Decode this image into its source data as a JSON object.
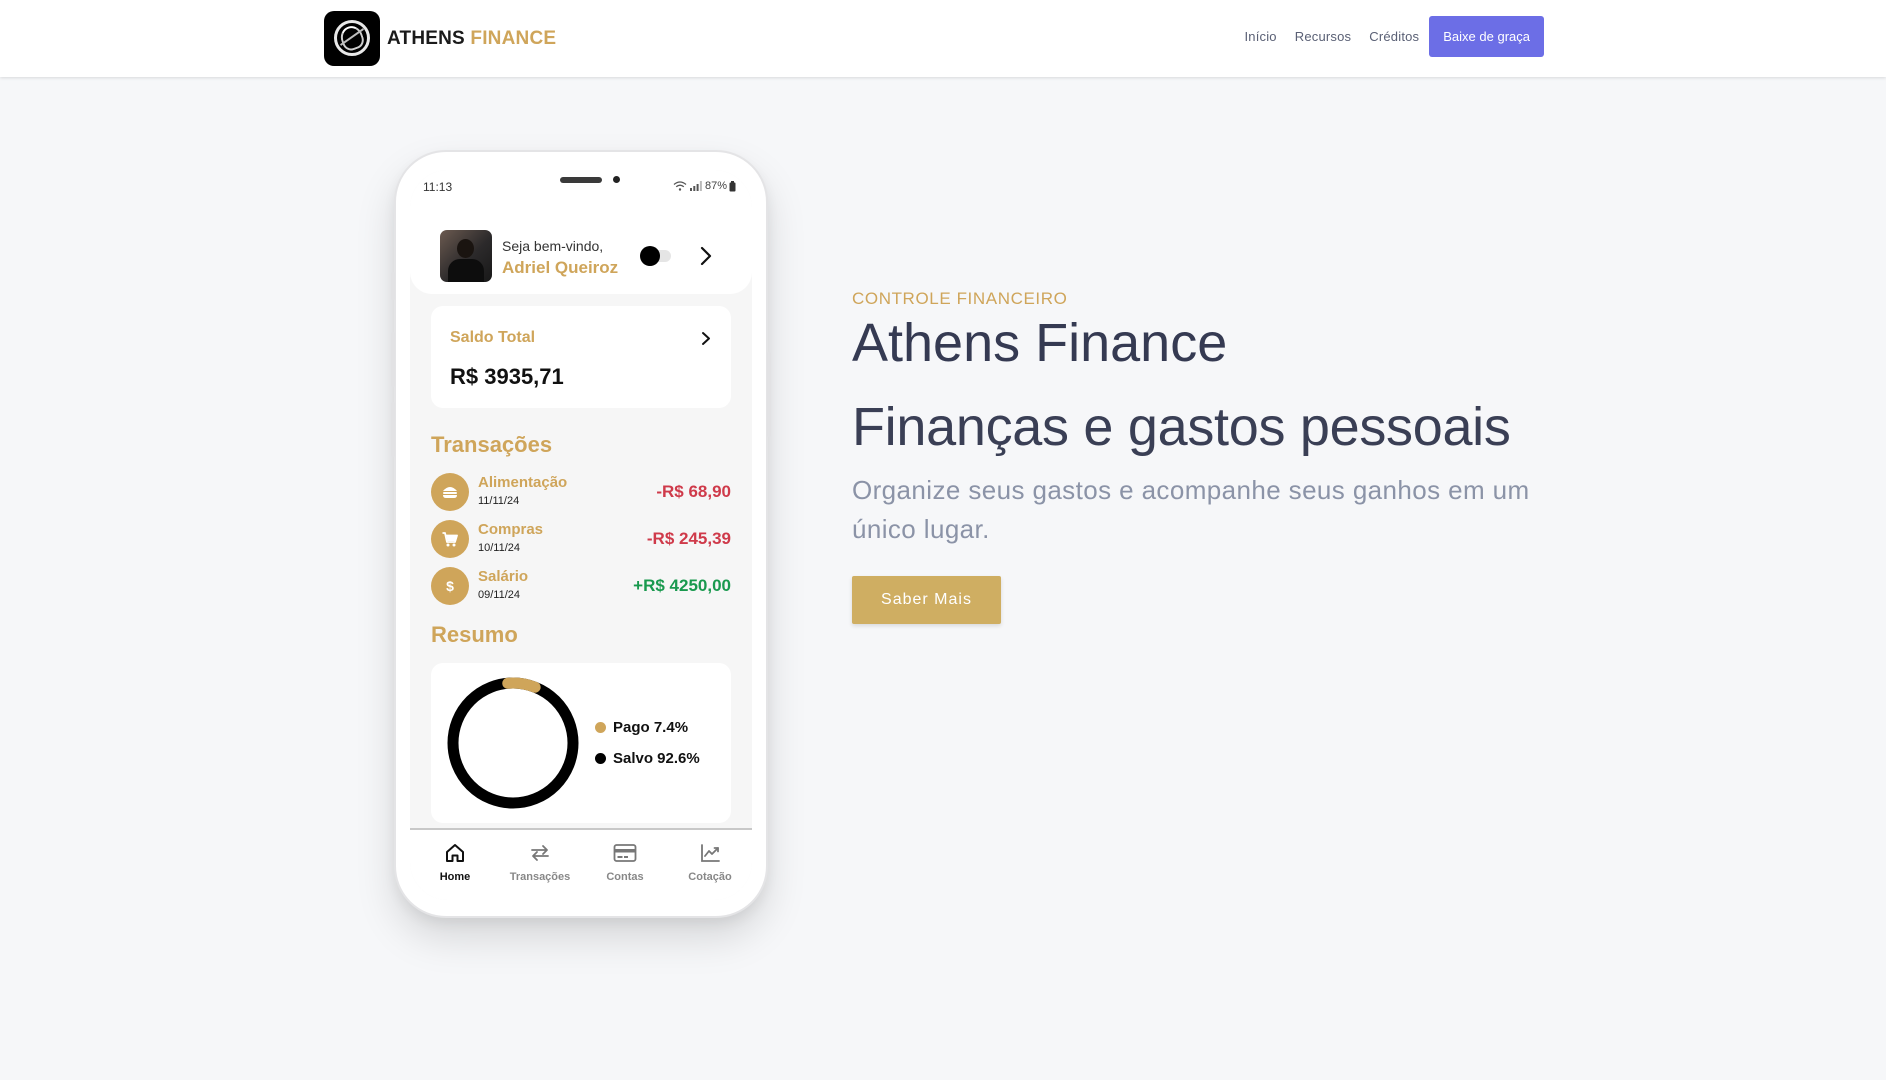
{
  "brand": {
    "name_primary": "ATHENS",
    "name_accent": "FINANCE"
  },
  "nav": {
    "links": [
      "Início",
      "Recursos",
      "Créditos"
    ],
    "cta": "Baixe de graça"
  },
  "phone": {
    "status": {
      "time": "11:13",
      "battery": "87%"
    },
    "welcome": {
      "greeting": "Seja bem-vindo,",
      "user_name": "Adriel Queiroz"
    },
    "balance": {
      "label": "Saldo Total",
      "value": "R$ 3935,71"
    },
    "transactions": {
      "title": "Transações",
      "items": [
        {
          "name": "Alimentação",
          "date": "11/11/24",
          "amount": "-R$ 68,90",
          "icon": "burger-icon"
        },
        {
          "name": "Compras",
          "date": "10/11/24",
          "amount": "-R$ 245,39",
          "icon": "cart-icon"
        },
        {
          "name": "Salário",
          "date": "09/11/24",
          "amount": "+R$ 4250,00",
          "icon": "dollar-icon",
          "icon_glyph": "$"
        }
      ]
    },
    "summary": {
      "title": "Resumo",
      "legend": [
        {
          "label": "Pago 7.4%",
          "color": "#cfa55a"
        },
        {
          "label": "Salvo 92.6%",
          "color": "#000000"
        }
      ],
      "pago_fraction": 0.074,
      "salvo_fraction": 0.926
    },
    "tabs": [
      {
        "label": "Home",
        "icon": "home-icon",
        "active": true
      },
      {
        "label": "Transações",
        "icon": "swap-icon",
        "active": false
      },
      {
        "label": "Contas",
        "icon": "card-icon",
        "active": false
      },
      {
        "label": "Cotação",
        "icon": "chart-line-icon",
        "active": false
      }
    ]
  },
  "hero": {
    "overline": "CONTROLE FINANCEIRO",
    "title": "Athens Finance",
    "subtitle": "Finanças e gastos pessoais",
    "description": "Organize seus gastos e acompanhe seus ganhos em um único lugar.",
    "button": "Saber Mais"
  },
  "colors": {
    "accent": "#cfa55a",
    "cta": "#6c6ee6",
    "negative": "#cf3a4a",
    "positive": "#19994e"
  }
}
